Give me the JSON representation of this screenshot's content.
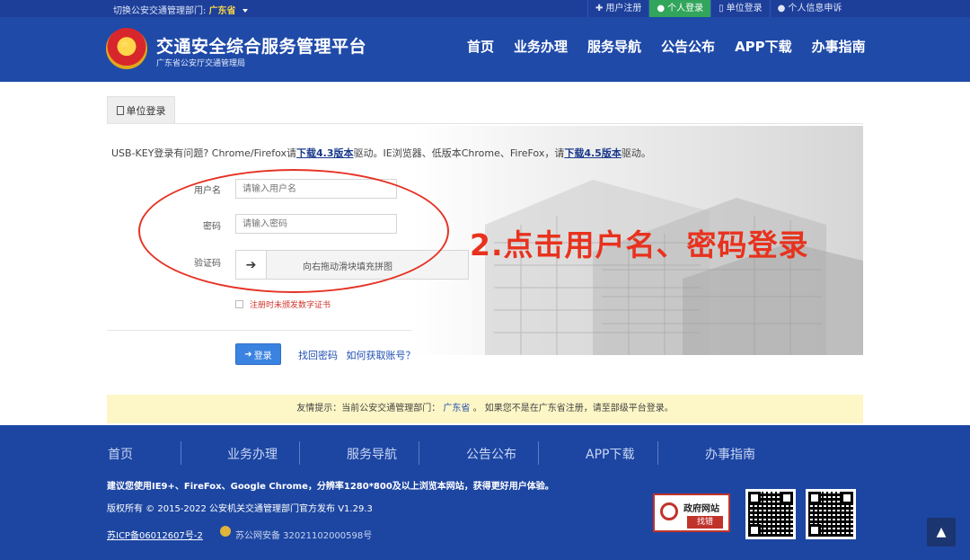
{
  "topbar": {
    "switch_prefix": "切换公安交通管理部门:",
    "switch_value": "广东省",
    "links": [
      {
        "icon": "plus-icon",
        "label": "用户注册"
      },
      {
        "icon": "user-icon",
        "label": "个人登录",
        "active": true
      },
      {
        "icon": "doc-icon",
        "label": "单位登录"
      },
      {
        "icon": "person-icon",
        "label": "个人信息申诉"
      }
    ]
  },
  "header": {
    "title": "交通安全综合服务管理平台",
    "subtitle": "广东省公安厅交通管理局",
    "nav": [
      "首页",
      "业务办理",
      "服务导航",
      "公告公布",
      "APP下载",
      "办事指南"
    ]
  },
  "tab": {
    "label": "单位登录"
  },
  "notice": {
    "text1": "USB-KEY登录有问题? Chrome/Firefox请",
    "link1": "下载4.3版本",
    "text2": "驱动。IE浏览器、低版本Chrome、FireFox，请",
    "link2": "下载4.5版本",
    "text3": "驱动。"
  },
  "form": {
    "username_label": "用户名",
    "username_placeholder": "请输入用户名",
    "password_label": "密码",
    "password_placeholder": "请输入密码",
    "captcha_label": "验证码",
    "slider_text": "向右拖动滑块填充拼图",
    "checkbox_label": "注册时未颁发数字证书",
    "login_label": "登录",
    "find_password": "找回密码",
    "get_account": "如何获取账号？"
  },
  "annotation": {
    "text": "2.点击用户名、密码登录",
    "color": "#e8321e"
  },
  "tip": {
    "prefix": "友情提示：当前公安交通管理部门：",
    "province": "广东省",
    "suffix": "。 如果您不是在广东省注册，请至部级平台登录。"
  },
  "footer": {
    "nav": [
      "首页",
      "业务办理",
      "服务导航",
      "公告公布",
      "APP下载",
      "办事指南"
    ],
    "line1": "建议您使用IE9+、FireFox、Google Chrome，分辨率1280*800及以上浏览本网站，获得更好用户体验。",
    "line2": "版权所有 © 2015-2022 公安机关交通管理部门官方发布 V1.29.3",
    "icp": "苏ICP备06012607号-2",
    "police": "苏公网安备 32021102000598号",
    "gov_badge_title": "政府网站",
    "gov_badge_action": "找错"
  },
  "colors": {
    "primary": "#1f4aa8",
    "active_green": "#31a55b",
    "tip_bg": "#fdf6c6",
    "login_btn": "#3a83e0"
  }
}
